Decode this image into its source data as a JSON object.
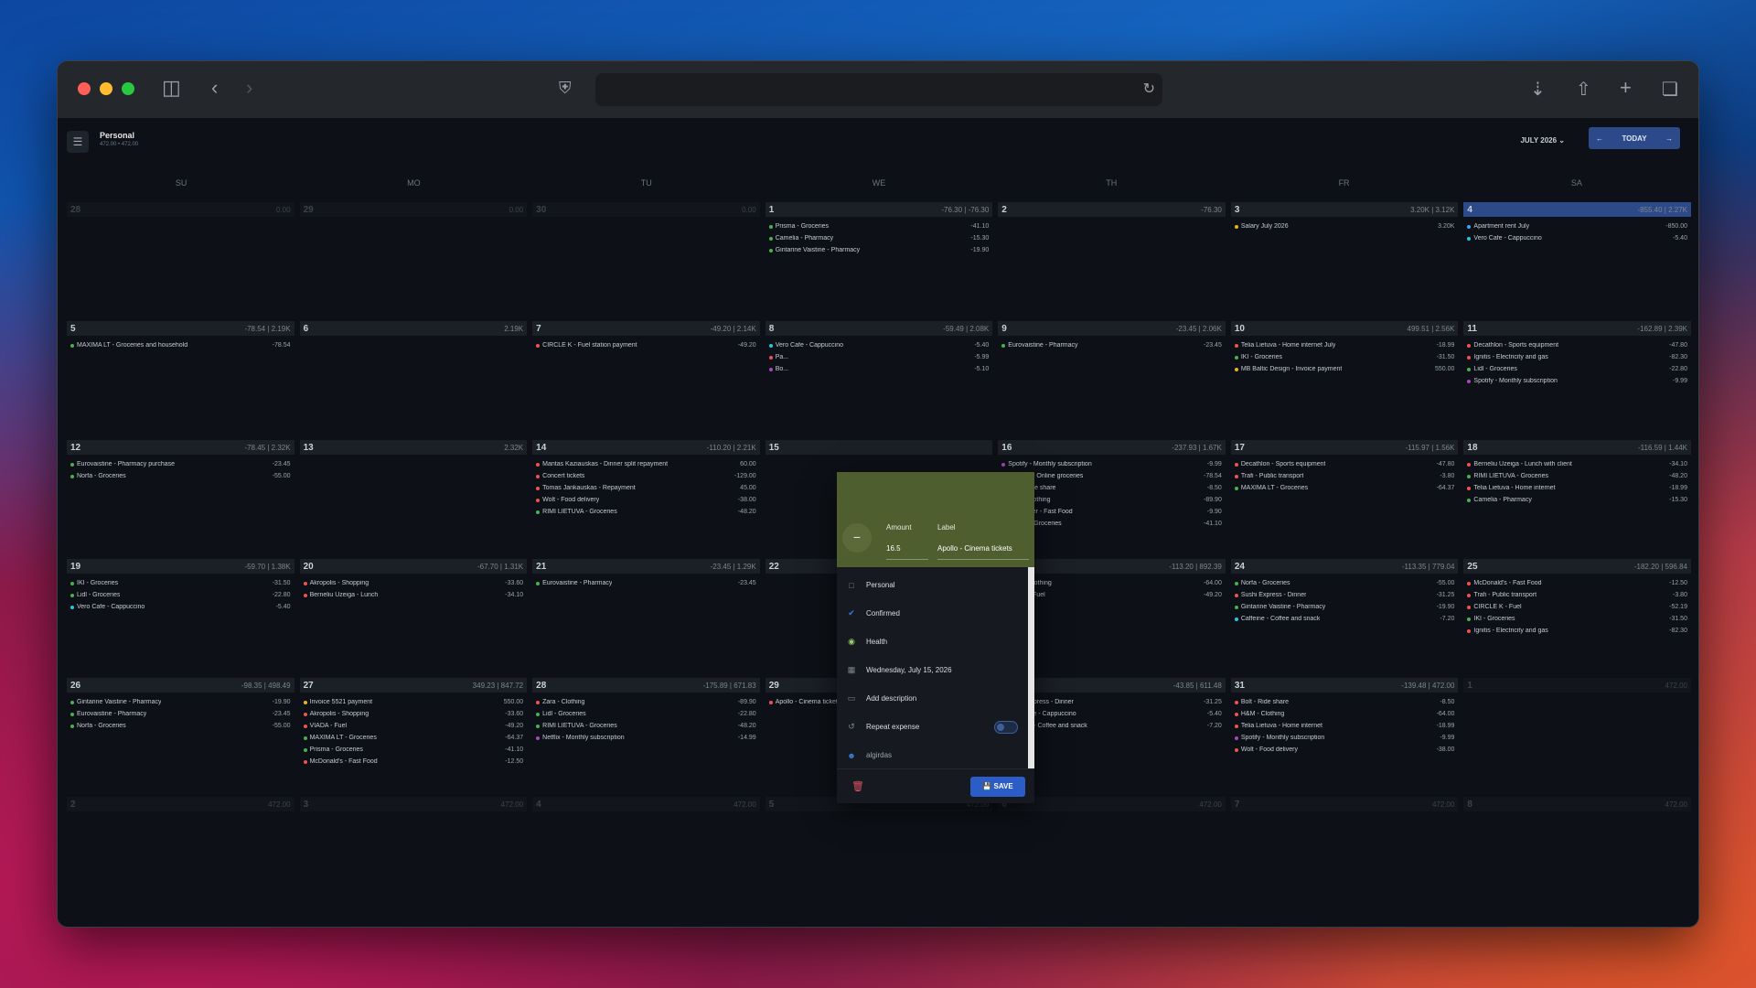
{
  "app": {
    "account_name": "Personal",
    "account_sub": "472.00 • 472.00",
    "month": "JULY 2026",
    "today": "TODAY"
  },
  "weekdays": [
    "SU",
    "MO",
    "TU",
    "WE",
    "TH",
    "FR",
    "SA"
  ],
  "colors": {
    "accent": "#2c4a8a",
    "panel": "#1b1f26",
    "modal_header": "#4f5e2e"
  },
  "weeks": [
    [
      {
        "day": "28",
        "sum": "0.00",
        "dim": true,
        "items": []
      },
      {
        "day": "29",
        "sum": "0.00",
        "dim": true,
        "items": []
      },
      {
        "day": "30",
        "sum": "0.00",
        "dim": true,
        "items": []
      },
      {
        "day": "1",
        "sum": "-76.30 | -76.30",
        "items": [
          {
            "label": "Prisma - Groceries",
            "amount": "-41.10",
            "color": "#4caf50"
          },
          {
            "label": "Camelia - Pharmacy",
            "amount": "-15.30",
            "color": "#4caf50"
          },
          {
            "label": "Gintarine Vaistine - Pharmacy",
            "amount": "-19.90",
            "color": "#4caf50"
          }
        ]
      },
      {
        "day": "2",
        "sum": "-76.30",
        "items": []
      },
      {
        "day": "3",
        "sum": "3.20K | 3.12K",
        "items": [
          {
            "label": "Salary July 2026",
            "amount": "3.20K",
            "color": "#e6b422"
          }
        ]
      },
      {
        "day": "4",
        "sum": "-855.40 | 2.27K",
        "today": true,
        "items": [
          {
            "label": "Apartment rent July",
            "amount": "-850.00",
            "color": "#42a5f5"
          },
          {
            "label": "Vero Cafe - Cappuccino",
            "amount": "-5.40",
            "color": "#26c6da"
          }
        ]
      }
    ],
    [
      {
        "day": "5",
        "sum": "-78.54 | 2.19K",
        "items": [
          {
            "label": "MAXIMA LT - Groceries and household",
            "amount": "-78.54",
            "color": "#4caf50"
          }
        ]
      },
      {
        "day": "6",
        "sum": "2.19K",
        "items": []
      },
      {
        "day": "7",
        "sum": "-49.20 | 2.14K",
        "items": [
          {
            "label": "CIRCLE K - Fuel station payment",
            "amount": "-49.20",
            "color": "#ef5350"
          }
        ]
      },
      {
        "day": "8",
        "sum": "-59.49 | 2.08K",
        "items": [
          {
            "label": "Vero Cafe - Cappuccino",
            "amount": "-5.40",
            "color": "#26c6da"
          },
          {
            "label": "Pa...",
            "amount": "-5.99",
            "color": "#ef5350"
          },
          {
            "label": "Bo...",
            "amount": "-5.10",
            "color": "#ab47bc"
          }
        ]
      },
      {
        "day": "9",
        "sum": "-23.45 | 2.06K",
        "items": [
          {
            "label": "Eurovaistine - Pharmacy",
            "amount": "-23.45",
            "color": "#4caf50"
          }
        ]
      },
      {
        "day": "10",
        "sum": "499.51 | 2.56K",
        "items": [
          {
            "label": "Telia Lietuva - Home internet July",
            "amount": "-18.99",
            "color": "#ef5350"
          },
          {
            "label": "IKI - Groceries",
            "amount": "-31.50",
            "color": "#4caf50"
          },
          {
            "label": "MB Baltic Design - Invoice payment",
            "amount": "550.00",
            "color": "#e6b422"
          }
        ]
      },
      {
        "day": "11",
        "sum": "-162.89 | 2.39K",
        "items": [
          {
            "label": "Decathlon - Sports equipment",
            "amount": "-47.80",
            "color": "#ef5350"
          },
          {
            "label": "Ignitis - Electricity and gas",
            "amount": "-82.30",
            "color": "#ef5350"
          },
          {
            "label": "Lidl - Groceries",
            "amount": "-22.80",
            "color": "#4caf50"
          },
          {
            "label": "Spotify - Monthly subscription",
            "amount": "-9.99",
            "color": "#ab47bc"
          }
        ]
      }
    ],
    [
      {
        "day": "12",
        "sum": "-78.45 | 2.32K",
        "items": [
          {
            "label": "Eurovaistine - Pharmacy purchase",
            "amount": "-23.45",
            "color": "#4caf50"
          },
          {
            "label": "Norfa - Groceries",
            "amount": "-55.00",
            "color": "#4caf50"
          }
        ]
      },
      {
        "day": "13",
        "sum": "2.32K",
        "items": []
      },
      {
        "day": "14",
        "sum": "-110.20 | 2.21K",
        "items": [
          {
            "label": "Mantas Kaziauskas - Dinner split repayment",
            "amount": "60.00",
            "color": "#ef5350"
          },
          {
            "label": "Concert tickets",
            "amount": "-129.00",
            "color": "#ef5350"
          },
          {
            "label": "Tomas Jankauskas - Repayment",
            "amount": "45.00",
            "color": "#ef5350"
          },
          {
            "label": "Wolt - Food delivery",
            "amount": "-38.00",
            "color": "#ef5350"
          },
          {
            "label": "RIMI LIETUVA - Groceries",
            "amount": "-48.20",
            "color": "#4caf50"
          }
        ]
      },
      {
        "day": "15",
        "sum": "",
        "items": []
      },
      {
        "day": "16",
        "sum": "-237.93 | 1.67K",
        "items": [
          {
            "label": "Spotify - Monthly subscription",
            "amount": "-9.99",
            "color": "#ab47bc"
          },
          {
            "label": "Barbora - Online groceries",
            "amount": "-78.54",
            "color": "#4caf50"
          },
          {
            "label": "Bolt - Ride share",
            "amount": "-8.50",
            "color": "#ef5350"
          },
          {
            "label": "Zara - Clothing",
            "amount": "-89.90",
            "color": "#ef5350"
          },
          {
            "label": "Hesburger - Fast Food",
            "amount": "-9.90",
            "color": "#ef5350"
          },
          {
            "label": "Prisma - Groceries",
            "amount": "-41.10",
            "color": "#4caf50"
          }
        ]
      },
      {
        "day": "17",
        "sum": "-115.97 | 1.56K",
        "items": [
          {
            "label": "Decathlon - Sports equipment",
            "amount": "-47.80",
            "color": "#ef5350"
          },
          {
            "label": "Trafi - Public transport",
            "amount": "-3.80",
            "color": "#ef5350"
          },
          {
            "label": "MAXIMA LT - Groceries",
            "amount": "-64.37",
            "color": "#4caf50"
          }
        ]
      },
      {
        "day": "18",
        "sum": "-116.59 | 1.44K",
        "items": [
          {
            "label": "Berneliu Uzeiga - Lunch with client",
            "amount": "-34.10",
            "color": "#ef5350"
          },
          {
            "label": "RIMI LIETUVA - Groceries",
            "amount": "-48.20",
            "color": "#4caf50"
          },
          {
            "label": "Telia Lietuva - Home internet",
            "amount": "-18.99",
            "color": "#ef5350"
          },
          {
            "label": "Camelia - Pharmacy",
            "amount": "-15.30",
            "color": "#4caf50"
          }
        ]
      }
    ],
    [
      {
        "day": "19",
        "sum": "-59.70 | 1.38K",
        "items": [
          {
            "label": "IKI - Groceries",
            "amount": "-31.50",
            "color": "#4caf50"
          },
          {
            "label": "Lidl - Groceries",
            "amount": "-22.80",
            "color": "#4caf50"
          },
          {
            "label": "Vero Cafe - Cappuccino",
            "amount": "-5.40",
            "color": "#26c6da"
          }
        ]
      },
      {
        "day": "20",
        "sum": "-67.70 | 1.31K",
        "items": [
          {
            "label": "Akropolis - Shopping",
            "amount": "-33.60",
            "color": "#ef5350"
          },
          {
            "label": "Berneliu Uzeiga - Lunch",
            "amount": "-34.10",
            "color": "#ef5350"
          }
        ]
      },
      {
        "day": "21",
        "sum": "-23.45 | 1.29K",
        "items": [
          {
            "label": "Eurovaistine - Pharmacy",
            "amount": "-23.45",
            "color": "#4caf50"
          }
        ]
      },
      {
        "day": "22",
        "sum": "",
        "items": []
      },
      {
        "day": "23",
        "sum": "-113.20 | 892.39",
        "items": [
          {
            "label": "H&M - Clothing",
            "amount": "-64.00",
            "color": "#ef5350"
          },
          {
            "label": "VIADA - Fuel",
            "amount": "-49.20",
            "color": "#ef5350"
          }
        ]
      },
      {
        "day": "24",
        "sum": "-113.35 | 779.04",
        "items": [
          {
            "label": "Norfa - Groceries",
            "amount": "-55.00",
            "color": "#4caf50"
          },
          {
            "label": "Sushi Express - Dinner",
            "amount": "-31.25",
            "color": "#ef5350"
          },
          {
            "label": "Gintarine Vaistine - Pharmacy",
            "amount": "-19.90",
            "color": "#4caf50"
          },
          {
            "label": "Caffeine - Coffee and snack",
            "amount": "-7.20",
            "color": "#26c6da"
          }
        ]
      },
      {
        "day": "25",
        "sum": "-182.20 | 596.84",
        "items": [
          {
            "label": "McDonald's - Fast Food",
            "amount": "-12.50",
            "color": "#ef5350"
          },
          {
            "label": "Trafi - Public transport",
            "amount": "-3.80",
            "color": "#ef5350"
          },
          {
            "label": "CIRCLE K - Fuel",
            "amount": "-52.19",
            "color": "#ef5350"
          },
          {
            "label": "IKI - Groceries",
            "amount": "-31.50",
            "color": "#4caf50"
          },
          {
            "label": "Ignitis - Electricity and gas",
            "amount": "-82.30",
            "color": "#ef5350"
          }
        ]
      }
    ],
    [
      {
        "day": "26",
        "sum": "-98.35 | 498.49",
        "items": [
          {
            "label": "Gintarine Vaistine - Pharmacy",
            "amount": "-19.90",
            "color": "#4caf50"
          },
          {
            "label": "Eurovaistine - Pharmacy",
            "amount": "-23.45",
            "color": "#4caf50"
          },
          {
            "label": "Norfa - Groceries",
            "amount": "-55.00",
            "color": "#4caf50"
          }
        ]
      },
      {
        "day": "27",
        "sum": "349.23 | 847.72",
        "items": [
          {
            "label": "Invoice 5521 payment",
            "amount": "550.00",
            "color": "#e6b422"
          },
          {
            "label": "Akropolis - Shopping",
            "amount": "-33.60",
            "color": "#ef5350"
          },
          {
            "label": "VIADA - Fuel",
            "amount": "-49.20",
            "color": "#ef5350"
          },
          {
            "label": "MAXIMA LT - Groceries",
            "amount": "-64.37",
            "color": "#4caf50"
          },
          {
            "label": "Prisma - Groceries",
            "amount": "-41.10",
            "color": "#4caf50"
          },
          {
            "label": "McDonald's - Fast Food",
            "amount": "-12.50",
            "color": "#ef5350"
          }
        ]
      },
      {
        "day": "28",
        "sum": "-175.89 | 671.83",
        "items": [
          {
            "label": "Zara - Clothing",
            "amount": "-89.90",
            "color": "#ef5350"
          },
          {
            "label": "Lidl - Groceries",
            "amount": "-22.80",
            "color": "#4caf50"
          },
          {
            "label": "RIMI LIETUVA - Groceries",
            "amount": "-48.20",
            "color": "#4caf50"
          },
          {
            "label": "Netflix - Monthly subscription",
            "amount": "-14.99",
            "color": "#ab47bc"
          }
        ]
      },
      {
        "day": "29",
        "sum": "-16.50 | 655.33",
        "items": [
          {
            "label": "Apollo - Cinema tickets",
            "amount": "-16.50",
            "color": "#ef5350"
          }
        ]
      },
      {
        "day": "30",
        "sum": "-43.85 | 611.48",
        "items": [
          {
            "label": "Sushi Express - Dinner",
            "amount": "-31.25",
            "color": "#ef5350"
          },
          {
            "label": "Vero Cafe - Cappuccino",
            "amount": "-5.40",
            "color": "#26c6da"
          },
          {
            "label": "Caffeine - Coffee and snack",
            "amount": "-7.20",
            "color": "#26c6da"
          }
        ]
      },
      {
        "day": "31",
        "sum": "-139.48 | 472.00",
        "items": [
          {
            "label": "Bolt - Ride share",
            "amount": "-8.50",
            "color": "#ef5350"
          },
          {
            "label": "H&M - Clothing",
            "amount": "-64.00",
            "color": "#ef5350"
          },
          {
            "label": "Telia Lietuva - Home internet",
            "amount": "-18.99",
            "color": "#ef5350"
          },
          {
            "label": "Spotify - Monthly subscription",
            "amount": "-9.99",
            "color": "#ab47bc"
          },
          {
            "label": "Wolt - Food delivery",
            "amount": "-38.00",
            "color": "#ef5350"
          }
        ]
      },
      {
        "day": "1",
        "sum": "472.00",
        "dim": true,
        "items": []
      }
    ],
    [
      {
        "day": "2",
        "sum": "472.00",
        "dim": true,
        "items": []
      },
      {
        "day": "3",
        "sum": "472.00",
        "dim": true,
        "items": []
      },
      {
        "day": "4",
        "sum": "472.00",
        "dim": true,
        "items": []
      },
      {
        "day": "5",
        "sum": "472.00",
        "dim": true,
        "items": []
      },
      {
        "day": "6",
        "sum": "472.00",
        "dim": true,
        "items": []
      },
      {
        "day": "7",
        "sum": "472.00",
        "dim": true,
        "items": []
      },
      {
        "day": "8",
        "sum": "472.00",
        "dim": true,
        "items": []
      }
    ]
  ],
  "modal": {
    "amount_label": "Amount",
    "amount_value": "16.5",
    "label_label": "Label",
    "label_value": "Apollo - Cinema tickets",
    "account": "Personal",
    "status": "Confirmed",
    "category": "Health",
    "date": "Wednesday, July 15, 2026",
    "description": "Add description",
    "repeat": "Repeat expense",
    "user": "algirdas",
    "save": "SAVE"
  }
}
